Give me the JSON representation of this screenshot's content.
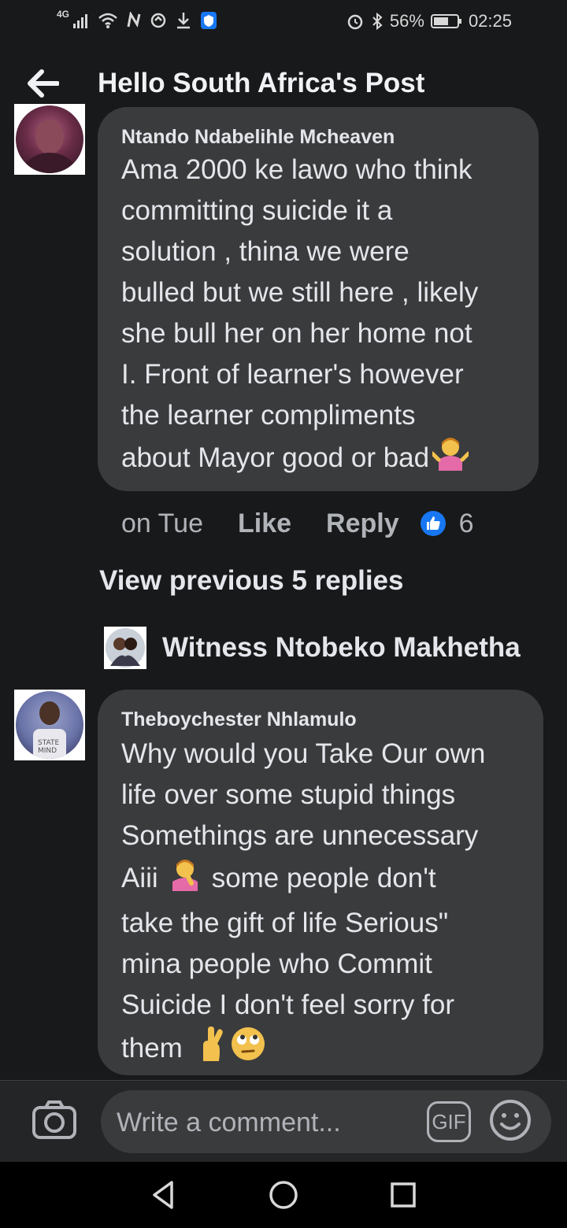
{
  "status_bar": {
    "network": "4G",
    "battery": "56%",
    "time": "02:25"
  },
  "header": {
    "title": "Hello South Africa's Post"
  },
  "comments": [
    {
      "author": "Ntando Ndabelihle Mcheaven",
      "lines": [
        "Ama 2000 ke lawo who think",
        "committing suicide it a",
        "solution , thina we were",
        "bulled but we still here , likely",
        "she bull her on her home not",
        "I. Front of learner's however",
        "the learner compliments",
        "about Mayor good or bad"
      ],
      "emoji": "woman-shrugging-emoji",
      "time": "on Tue",
      "like_label": "Like",
      "reply_label": "Reply",
      "like_count": "6"
    },
    {
      "author": "Theboychester Nhlamulo",
      "lines": [
        "Why would you Take Our own",
        "life over some stupid things",
        "Somethings are unnecessary",
        "Aiii",
        "some people don't",
        "take the gift of life Serious\"",
        "mina people who Commit",
        "Suicide I don't feel sorry for",
        "them"
      ],
      "emojis": [
        "woman-facepalming-emoji",
        "crossed-fingers-emoji",
        "face-with-rolling-eyes-emoji"
      ]
    }
  ],
  "view_previous": "View previous 5 replies",
  "reply_thread": {
    "name": "Witness Ntobeko Makhetha"
  },
  "composer": {
    "placeholder": "Write a comment...",
    "gif_label": "GIF"
  },
  "colors": {
    "background": "#18191a",
    "bubble": "#3a3b3c",
    "text": "#e4e6eb",
    "secondary": "#b0b3b8",
    "like_blue": "#1877f2"
  }
}
